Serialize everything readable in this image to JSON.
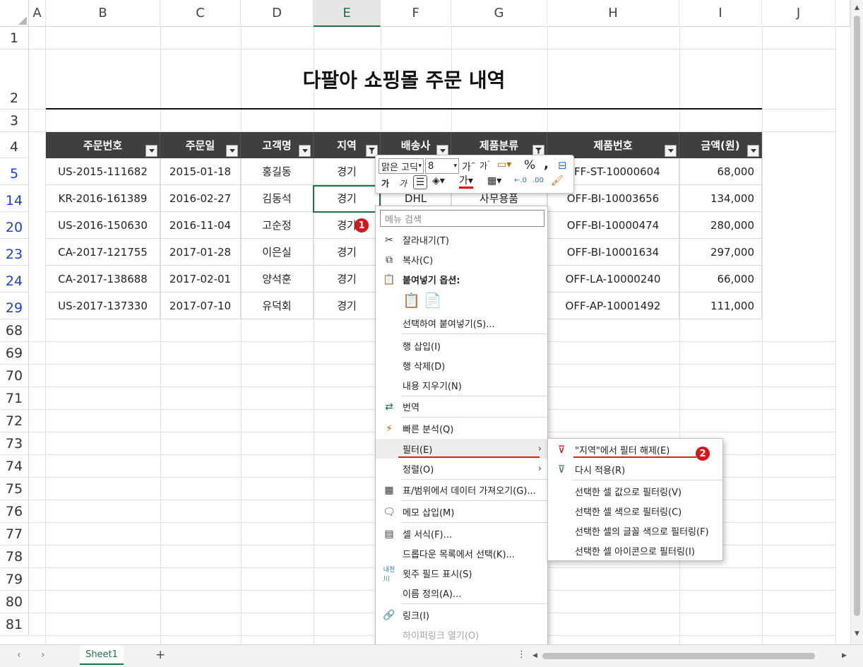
{
  "columns": [
    "A",
    "B",
    "C",
    "D",
    "E",
    "F",
    "G",
    "H",
    "I",
    "J"
  ],
  "rows": [
    "1",
    "2",
    "3",
    "4",
    "5",
    "14",
    "20",
    "23",
    "24",
    "29",
    "68",
    "69",
    "70",
    "71",
    "72",
    "73",
    "74",
    "75",
    "76",
    "77",
    "78",
    "79",
    "80",
    "81"
  ],
  "title": "다팔아 쇼핑몰 주문 내역",
  "headers": [
    "주문번호",
    "주문일",
    "고객명",
    "지역",
    "배송사",
    "제품분류",
    "제품번호",
    "금액(원)"
  ],
  "table": [
    [
      "US-2015-111682",
      "2015-01-18",
      "홍길동",
      "경기",
      "",
      "",
      "OFF-ST-10000604",
      "68,000"
    ],
    [
      "KR-2016-161389",
      "2016-02-27",
      "김동석",
      "경기",
      "DHL",
      "사무용품",
      "OFF-BI-10003656",
      "134,000"
    ],
    [
      "US-2016-150630",
      "2016-11-04",
      "고순정",
      "경기",
      "",
      "",
      "OFF-BI-10000474",
      "280,000"
    ],
    [
      "CA-2017-121755",
      "2017-01-28",
      "이은실",
      "경기",
      "",
      "",
      "OFF-BI-10001634",
      "297,000"
    ],
    [
      "CA-2017-138688",
      "2017-02-01",
      "양석훈",
      "경기",
      "",
      "",
      "OFF-LA-10000240",
      "66,000"
    ],
    [
      "US-2017-137330",
      "2017-07-10",
      "유덕회",
      "경기",
      "",
      "",
      "OFF-AP-10001492",
      "111,000"
    ]
  ],
  "mini_toolbar": {
    "font": "맑은 고딕",
    "size": "8",
    "bold": "가",
    "italic": "가",
    "percent": "%",
    "comma": ","
  },
  "context_menu": {
    "search_placeholder": "메뉴 검색",
    "items": [
      "잘라내기(T)",
      "복사(C)",
      "붙여넣기 옵션:",
      "선택하여 붙여넣기(S)...",
      "행 삽입(I)",
      "행 삭제(D)",
      "내용 지우기(N)",
      "번역",
      "빠른 분석(Q)",
      "필터(E)",
      "정렬(O)",
      "표/범위에서 데이터 가져오기(G)...",
      "메모 삽입(M)",
      "셀 서식(F)...",
      "드롭다운 목록에서 선택(K)...",
      "윗주 필드 표시(S)",
      "이름 정의(A)...",
      "링크(I)",
      "하이퍼링크 열기(O)"
    ]
  },
  "submenu": {
    "items": [
      "\"지역\"에서 필터 해제(E)",
      "다시 적용(R)",
      "선택한 셀 값으로 필터링(V)",
      "선택한 셀 색으로 필터링(C)",
      "선택한 셀의 글꼴 색으로 필터링(F)",
      "선택한 셀 아이콘으로 필터링(I)"
    ]
  },
  "badges": [
    "1",
    "2"
  ],
  "sheet_tab": "Sheet1",
  "add_sheet": "+",
  "colors": {
    "header_bg": "#3f3f3f",
    "accent": "#1e7145",
    "badge": "#d8141c",
    "filtered_row": "#1f3fcf"
  }
}
